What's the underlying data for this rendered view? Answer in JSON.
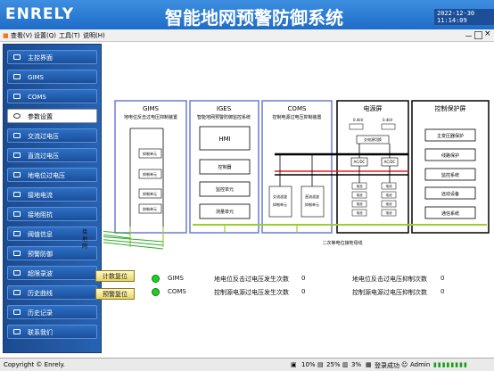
{
  "header": {
    "logo": "ENRELY",
    "title": "智能地网预警防御系统",
    "clock": "2022-12-30 11:14:09"
  },
  "menu": [
    {
      "label": "查看(V)"
    },
    {
      "label": "设置(Q)"
    },
    {
      "label": "工具(T)"
    },
    {
      "label": "说明(H)"
    }
  ],
  "sidebar": {
    "items": [
      {
        "label": "主控界面",
        "icon": "monitor-icon"
      },
      {
        "label": "GIMS",
        "icon": "panel-icon"
      },
      {
        "label": "COMS",
        "icon": "panel-icon"
      },
      {
        "label": "参数设置",
        "icon": "gear-icon"
      },
      {
        "label": "交流过电压",
        "icon": "wave-icon"
      },
      {
        "label": "直流过电压",
        "icon": "wave-icon"
      },
      {
        "label": "地电位过电压",
        "icon": "wave-icon"
      },
      {
        "label": "接地电流",
        "icon": "current-icon"
      },
      {
        "label": "接地阻抗",
        "icon": "chart-icon"
      },
      {
        "label": "阈值信息",
        "icon": "info-icon"
      },
      {
        "label": "预警防御",
        "icon": "shield-icon"
      },
      {
        "label": "超限录波",
        "icon": "record-icon"
      },
      {
        "label": "历史曲线",
        "icon": "curve-icon"
      },
      {
        "label": "历史记录",
        "icon": "log-icon"
      },
      {
        "label": "联系我们",
        "icon": "contact-icon"
      }
    ]
  },
  "diagram": {
    "gims": {
      "title": "GIMS",
      "subtitle": "地电位反击过电压抑制装置",
      "units": [
        "抑制单元",
        "抑制单元",
        "抑制单元",
        "抑制单元"
      ]
    },
    "iges": {
      "title": "IGES",
      "subtitle": "智能地网预警防御监控系统",
      "hmi": "HMI",
      "boxes": [
        "控制器",
        "监控单元",
        "测量单元"
      ]
    },
    "coms": {
      "title": "COMS",
      "subtitle": "控制电源过电压抑制装置",
      "boxes": [
        "交流滤波抑制单元",
        "直流滤波抑制单元"
      ]
    },
    "power": {
      "title": "电源屏",
      "supply": "交电源切换",
      "v1": "0.4kV",
      "v2": "0.4kV",
      "acdc": "AC/DC",
      "cells": "电池"
    },
    "protection": {
      "title": "控制保护屏",
      "boxes": [
        "主变压器保护",
        "线路保护",
        "监控系统",
        "远动设备",
        "通信系统"
      ]
    },
    "grid_label": "接地网",
    "bus_label": "二次等电位接地母线"
  },
  "controls": {
    "count_reset": "计数复位",
    "alarm_reset": "预警复位"
  },
  "status": [
    {
      "name": "GIMS",
      "color": "#1fd11f",
      "event1": "地电位反击过电压发生次数",
      "v1": "0",
      "event2": "地电位反击过电压抑制次数",
      "v2": "0"
    },
    {
      "name": "COMS",
      "color": "#1fd11f",
      "event1": "控制源电源过电压发生次数",
      "v1": "0",
      "event2": "控制源电源过电压抑制次数",
      "v2": "0"
    }
  ],
  "statusbar": {
    "copyright": "Copyright © Enrely.",
    "cpu": "10%",
    "mem": "25%",
    "disk": "3%",
    "login": "登录成功",
    "user": "Admin"
  }
}
